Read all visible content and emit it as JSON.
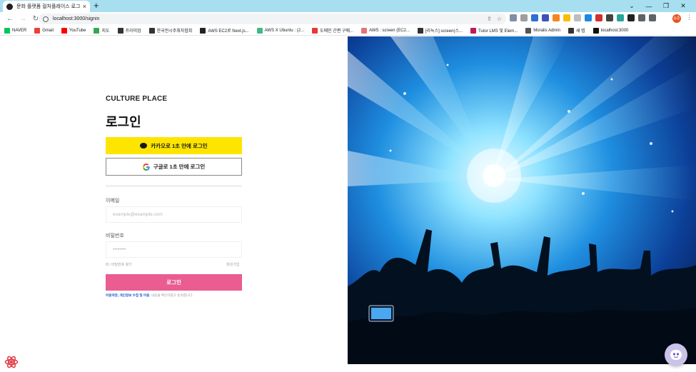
{
  "browser": {
    "tab_title": "문화 플랫폼 컬처플레이스 로그인",
    "tab_close": "×",
    "new_tab": "+",
    "url": "localhost:3000/signin",
    "controls": {
      "minimize": "—",
      "restore": "❐",
      "close": "✕"
    },
    "profile_initials": "승준",
    "bookmarks": [
      {
        "label": "NAVER",
        "icon": "naver-icon",
        "color": "#03c75a"
      },
      {
        "label": "Gmail",
        "icon": "gmail-icon",
        "color": "#ea4335"
      },
      {
        "label": "YouTube",
        "icon": "youtube-icon",
        "color": "#ff0000"
      },
      {
        "label": "지도",
        "icon": "map-icon",
        "color": "#34a853"
      },
      {
        "label": "프리미엄",
        "icon": "wix-icon",
        "color": "#333333"
      },
      {
        "label": "한국전시주최자협회",
        "icon": "globe-icon",
        "color": "#333333"
      },
      {
        "label": "AWS EC2로 Next.js...",
        "icon": "bookmark-icon",
        "color": "#222222"
      },
      {
        "label": "AWS X Ubuntu : (2...",
        "icon": "vue-icon",
        "color": "#41b883"
      },
      {
        "label": "도메인 간편 구매...",
        "icon": "domain-icon",
        "color": "#e53935"
      },
      {
        "label": "AWS : screen (EC2...",
        "icon": "screen-icon",
        "color": "#e57373"
      },
      {
        "label": "[리눅스] screen(스...",
        "icon": "tistory-icon",
        "color": "#333333"
      },
      {
        "label": "Tutor LMS 및 Elem...",
        "icon": "tutor-icon",
        "color": "#c2185b"
      },
      {
        "label": "Moralis Admin",
        "icon": "moralis-icon",
        "color": "#555555"
      },
      {
        "label": "새 탭",
        "icon": "globe-icon",
        "color": "#333333"
      },
      {
        "label": "localhost:3000",
        "icon": "next-icon",
        "color": "#111111"
      }
    ]
  },
  "signin": {
    "brand": "CULTURE PLACE",
    "heading": "로그인",
    "kakao_label": "카카오로 1초 만에 로그인",
    "google_label": "구글로 1초 만에 로그인",
    "email_label": "이메일",
    "email_placeholder": "example@example.com",
    "password_label": "비밀번호",
    "password_placeholder": "••••••••",
    "find_label": "ID, 비밀번호 찾기",
    "signup_label": "회원가입",
    "login_label": "로그인",
    "terms_link1": "이용약관",
    "terms_sep": ", ",
    "terms_link2": "개인정보 수집 및 이용",
    "terms_text": ", 내용을 확인하였고 동의합니다."
  },
  "colors": {
    "kakao": "#fee500",
    "login_button": "#eb5c91",
    "terms_link": "#1d58c9",
    "titlebar": "#a8dff0"
  }
}
